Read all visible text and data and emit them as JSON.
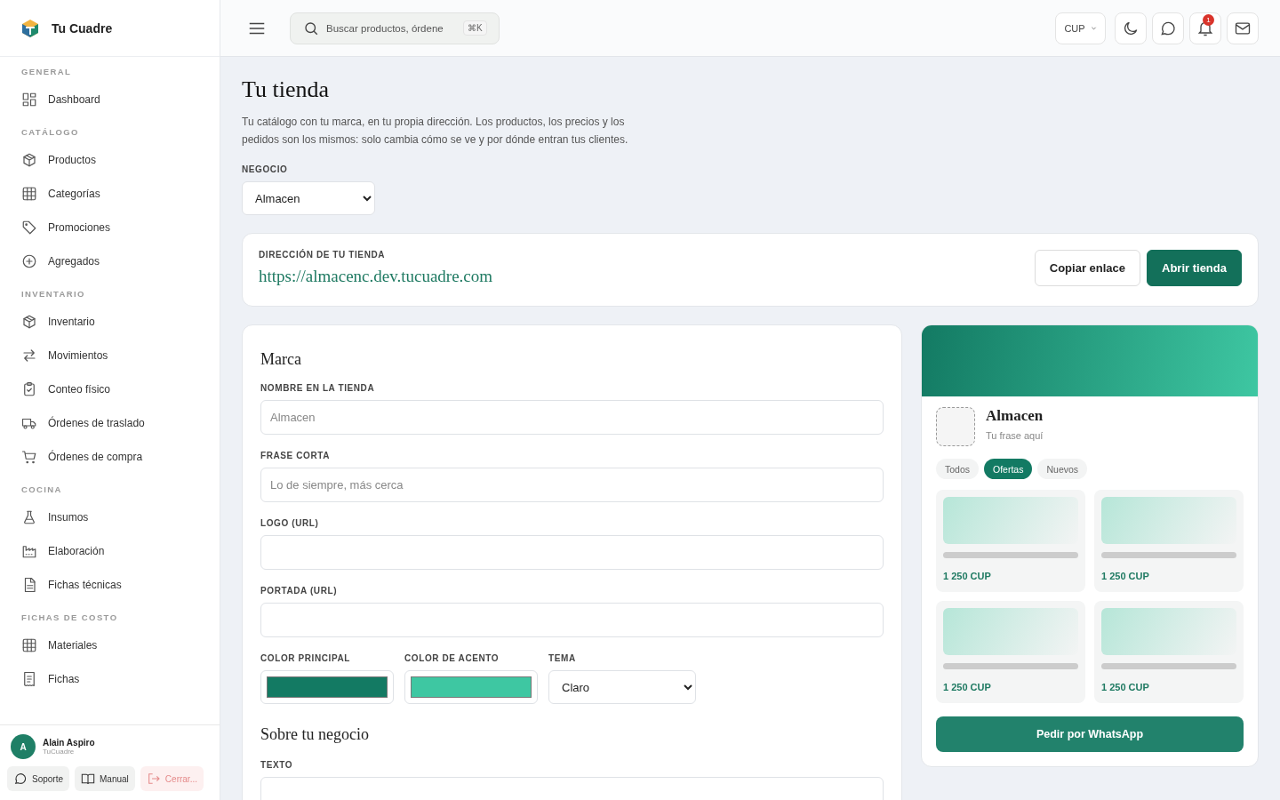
{
  "brand": {
    "name": "Tu Cuadre"
  },
  "sidebar": {
    "sections": [
      {
        "title": "GENERAL",
        "items": [
          {
            "label": "Dashboard"
          }
        ]
      },
      {
        "title": "CATÁLOGO",
        "items": [
          {
            "label": "Productos"
          },
          {
            "label": "Categorías"
          },
          {
            "label": "Promociones"
          },
          {
            "label": "Agregados"
          }
        ]
      },
      {
        "title": "INVENTARIO",
        "items": [
          {
            "label": "Inventario"
          },
          {
            "label": "Movimientos"
          },
          {
            "label": "Conteo físico"
          },
          {
            "label": "Órdenes de traslado"
          },
          {
            "label": "Órdenes de compra"
          }
        ]
      },
      {
        "title": "COCINA",
        "items": [
          {
            "label": "Insumos"
          },
          {
            "label": "Elaboración"
          },
          {
            "label": "Fichas técnicas"
          }
        ]
      },
      {
        "title": "FICHAS DE COSTO",
        "items": [
          {
            "label": "Materiales"
          },
          {
            "label": "Fichas"
          }
        ]
      }
    ]
  },
  "user": {
    "initial": "A",
    "name": "Alain Aspiro",
    "org": "TuCuadre"
  },
  "footer_buttons": [
    {
      "label": "Soporte",
      "kind": "normal"
    },
    {
      "label": "Manual",
      "kind": "normal"
    },
    {
      "label": "Cerrar...",
      "kind": "danger"
    }
  ],
  "topbar": {
    "search_placeholder": "Buscar productos, órdene",
    "shortcut": "⌘K",
    "currency": "CUP",
    "notifications": "1"
  },
  "page": {
    "title": "Tu tienda",
    "description": "Tu catálogo con tu marca, en tu propia dirección. Los productos, los precios y los pedidos son los mismos: solo cambia cómo se ve y por dónde entran tus clientes.",
    "business_label": "NEGOCIO",
    "business_value": "Almacen"
  },
  "address": {
    "label": "DIRECCIÓN DE TU TIENDA",
    "url": "https://almacenc.dev.tucuadre.com",
    "buttons": [
      {
        "label": "Copiar enlace",
        "kind": "secondary"
      },
      {
        "label": "Abrir tienda",
        "kind": "primary"
      }
    ]
  },
  "brand_form": {
    "title": "Marca",
    "fields": [
      {
        "label": "NOMBRE EN LA TIENDA",
        "placeholder": "Almacen"
      },
      {
        "label": "FRASE CORTA",
        "placeholder": "Lo de siempre, más cerca"
      },
      {
        "label": "LOGO (URL)"
      },
      {
        "label": "PORTADA (URL)"
      }
    ],
    "row": [
      {
        "label": "COLOR PRINCIPAL",
        "kind": "color",
        "color": "#137a63"
      },
      {
        "label": "COLOR DE ACENTO",
        "kind": "color",
        "color": "#3ec7a2"
      },
      {
        "label": "TEMA",
        "kind": "select",
        "value": "Claro"
      }
    ],
    "about_title": "Sobre tu negocio",
    "text_label": "TEXTO"
  },
  "preview": {
    "name": "Almacen",
    "tagline": "Tu frase aquí",
    "chips": [
      {
        "label": "Todos",
        "selected": false
      },
      {
        "label": "Ofertas",
        "selected": true
      },
      {
        "label": "Nuevos",
        "selected": false
      }
    ],
    "products": [
      {
        "price": "1 250 CUP"
      },
      {
        "price": "1 250 CUP"
      },
      {
        "price": "1 250 CUP"
      },
      {
        "price": "1 250 CUP"
      }
    ],
    "button": "Pedir por WhatsApp"
  }
}
